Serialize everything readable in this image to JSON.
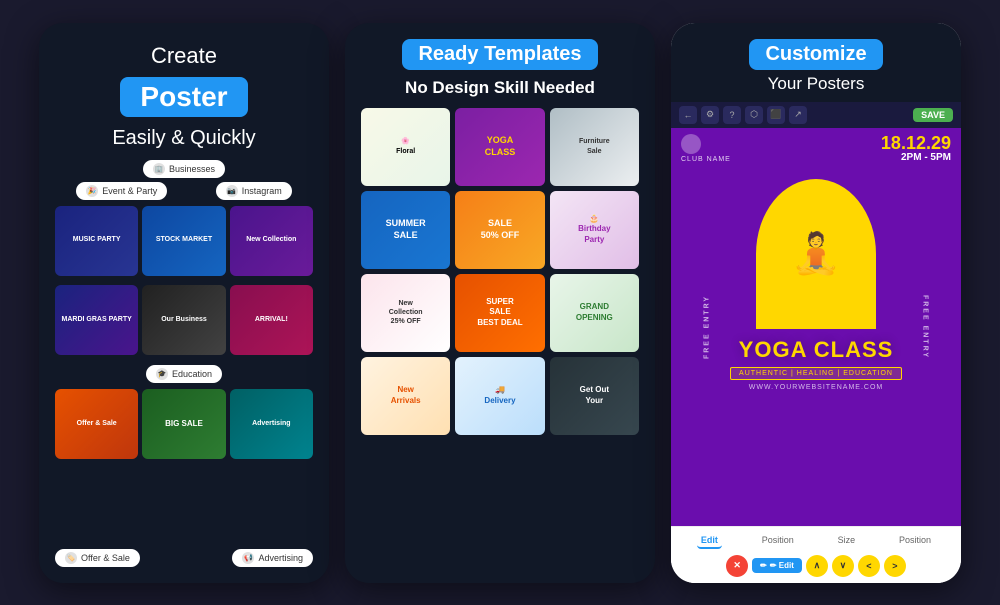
{
  "card1": {
    "title": "Create",
    "poster_badge": "Poster",
    "subtitle": "Easily & Quickly",
    "categories": [
      {
        "label": "Businesses",
        "icon": "🏢"
      },
      {
        "label": "Event & Party",
        "icon": "🎉"
      },
      {
        "label": "Instagram",
        "icon": "📷"
      },
      {
        "label": "Education",
        "icon": "🎓"
      },
      {
        "label": "Offer & Sale",
        "icon": "🏷️"
      },
      {
        "label": "Advertising",
        "icon": "📢"
      }
    ],
    "posters": [
      {
        "label": "MUSIC PARTY",
        "style": "mp-music"
      },
      {
        "label": "STOCK MARKET",
        "style": "mp-stock"
      },
      {
        "label": "New Collection",
        "style": "mp-fashion"
      },
      {
        "label": "MARDI GRAS PARTY",
        "style": "mp-mardi"
      },
      {
        "label": "Our Business",
        "style": "mp-business"
      },
      {
        "label": "ARRIVAL!",
        "style": "mp-arrival"
      },
      {
        "label": "Offer & Sale",
        "style": "mp-offer"
      },
      {
        "label": "BIG SALE",
        "style": "mp-sale"
      },
      {
        "label": "Advertising",
        "style": "mp-adv"
      }
    ]
  },
  "card2": {
    "badge": "Ready Templates",
    "subheader": "No Design Skill Needed",
    "templates": [
      {
        "label": "Floral",
        "style": "tt-floral",
        "text": "🌸"
      },
      {
        "label": "YOGA CLASS",
        "style": "tt-yoga",
        "text": "YOGA CLASS"
      },
      {
        "label": "Furniture Sale",
        "style": "tt-furniture",
        "text": "Furniture\nSale"
      },
      {
        "label": "SUMMER\nSALE",
        "style": "tt-summer",
        "text": "SUMMER\nSALE"
      },
      {
        "label": "SALE 50% OFF",
        "style": "tt-sale",
        "text": "SALE\n50% OFF"
      },
      {
        "label": "Birthday Party",
        "style": "tt-birthday",
        "text": "🎂 Birthday\nParty"
      },
      {
        "label": "New\nCollection\n25% OFF",
        "style": "tt-collection",
        "text": "New\nCollection\n25% OFF"
      },
      {
        "label": "SUPER SALE\nBEST DEAL",
        "style": "tt-supersale",
        "text": "SUPER\nSALE\nBEST DEAL"
      },
      {
        "label": "GRAND\nOPENING",
        "style": "tt-grand",
        "text": "GRAND\nOPENING"
      },
      {
        "label": "New Arrivals",
        "style": "tt-new2",
        "text": "New\nArrivals"
      },
      {
        "label": "Delivery",
        "style": "tt-delivery",
        "text": "🚚\nDelivery"
      },
      {
        "label": "Get Out\nYour",
        "style": "tt-getyour",
        "text": "Get Out\nYour"
      }
    ]
  },
  "card3": {
    "badge": "Customize",
    "subtitle": "Your Posters",
    "phone_bar": {
      "icons": [
        "←",
        "⚙",
        "?",
        "⬡",
        "⬛",
        "↗"
      ],
      "save": "SAVE"
    },
    "poster": {
      "club_name": "CLUB NAME",
      "date": "18.12.29",
      "time": "2PM - 5PM",
      "free_entry": "FREE ENTRY",
      "title": "YOGA CLASS",
      "tagline": "AUTHENTIC | HEALING | EDUCATION",
      "website": "WWW.YOURWEBSITENAME.COM"
    },
    "bottom_tabs": [
      "Edit",
      "Position",
      "Size",
      "Position"
    ],
    "actions": {
      "edit": "✏ Edit",
      "buttons": [
        "∧",
        "∨",
        "<",
        ">"
      ]
    }
  }
}
